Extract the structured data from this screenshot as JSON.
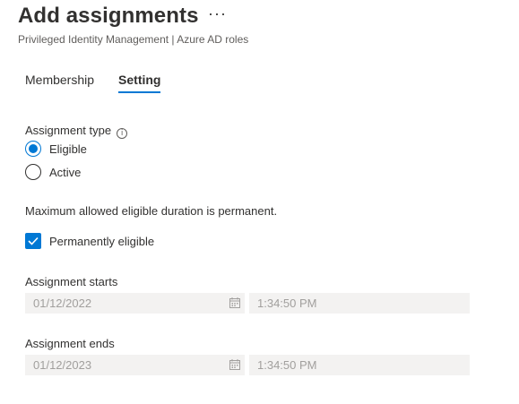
{
  "header": {
    "title": "Add assignments",
    "more_glyph": "···",
    "subtitle": "Privileged Identity Management | Azure AD roles"
  },
  "tabs": [
    {
      "label": "Membership",
      "active": false
    },
    {
      "label": "Setting",
      "active": true
    }
  ],
  "assignment_type": {
    "label": "Assignment type",
    "info_glyph": "i",
    "options": [
      {
        "label": "Eligible",
        "selected": true
      },
      {
        "label": "Active",
        "selected": false
      }
    ]
  },
  "duration_note": "Maximum allowed eligible duration is permanent.",
  "permanently_eligible": {
    "label": "Permanently eligible",
    "checked": true
  },
  "assignment_starts": {
    "label": "Assignment starts",
    "date": "01/12/2022",
    "time": "1:34:50 PM"
  },
  "assignment_ends": {
    "label": "Assignment ends",
    "date": "01/12/2023",
    "time": "1:34:50 PM"
  },
  "colors": {
    "accent": "#0078d4",
    "disabled_field_bg": "#f3f2f1",
    "disabled_text": "#a19f9d"
  },
  "icons": [
    "more-icon",
    "info-icon",
    "checkmark-icon",
    "calendar-icon"
  ]
}
